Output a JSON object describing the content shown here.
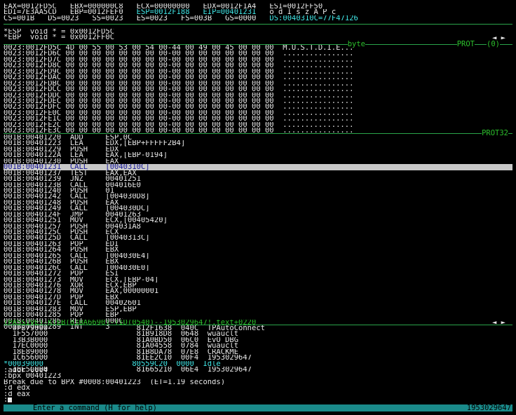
{
  "registers": {
    "row1": [
      "EAX=0012FD5C",
      "EBX=000000C8",
      "ECX=00000000",
      "EDX=0012F1A4",
      "ESI=0012FF50"
    ],
    "row2": [
      "EDI=7E3AA5CD",
      "EBP=0012FEF0",
      "ESP=0012F188",
      "EIP=00401231",
      "o d I s z A P c"
    ],
    "row3": [
      "CS=001B",
      "DS=0023",
      "SS=0023",
      "ES=0023",
      "FS=003B",
      "GS=0000",
      "DS:0040310C=77F47126"
    ]
  },
  "watch": {
    "lines": [
      "*ESP  void * = 0x0012FD5C",
      "*EBP  void * = 0x0012FF0C"
    ],
    "arrows": "◄ ►"
  },
  "data_window": {
    "header": "byte",
    "header_right": "PROT",
    "header_count": "(0)",
    "rows": [
      "0023:0012FD5C 4D 00 55 00 53 00 54 00-44 00 49 00 45 00 00 00  M.U.S.T.D.I.E...",
      "0023:0012FD6C 00 00 00 00 00 00 00 00-00 00 00 00 00 00 00 00  ................",
      "0023:0012FD7C 00 00 00 00 00 00 00 00-00 00 00 00 00 00 00 00  ................",
      "0023:0012FD8C 00 00 00 00 00 00 00 00-00 00 00 00 00 00 00 00  ................",
      "0023:0012FD9C 00 00 00 00 00 00 00 00-00 00 00 00 00 00 00 00  ................",
      "0023:0012FDAC 00 00 00 00 00 00 00 00-00 00 00 00 00 00 00 00  ................",
      "0023:0012FDBC 00 00 00 00 00 00 00 00-00 00 00 00 00 00 00 00  ................",
      "0023:0012FDCC 00 00 00 00 00 00 00 00-00 00 00 00 00 00 00 00  ................",
      "0023:0012FDDC 00 00 00 00 00 00 00 00-00 00 00 00 00 00 00 00  ................",
      "0023:0012FDEC 00 00 00 00 00 00 00 00-00 00 00 00 00 00 00 00  ................",
      "0023:0012FDFC 00 00 00 00 00 00 00 00-00 00 00 00 00 00 00 00  ................",
      "0023:0012FE0C 00 00 00 00 00 00 00 00-00 00 00 00 00 00 00 00  ................",
      "0023:0012FE1C 00 00 00 00 00 00 00 00-00 00 00 00 00 00 00 00  ................",
      "0023:0012FE2C 00 00 00 00 00 00 00 00-00 00 00 00 00 00 00 00  ................",
      "0023:0012FE3C 00 00 00 00 00 00 00 00-00 00 00 00 00 00 00 00  ................"
    ]
  },
  "code_window": {
    "header_right": "PROT32",
    "highlight_index": 5,
    "rows": [
      "001B:00401220  ADD     ESP,0C",
      "001B:00401223  LEA     EDX,[EBP+FFFFF2B4]",
      "001B:00401229  PUSH    EDX",
      "001B:0040122A  LEA     EAX,[EBP-0194]",
      "001B:00401230  PUSH    EAX",
      "001B:00401231  CALL    [0040310C]",
      "001B:00401237  TEST    EAX,EAX",
      "001B:00401239  JNZ     00401251",
      "001B:0040123B  CALL    004016E0",
      "001B:00401240  PUSH    01",
      "001B:00401242  CALL    [004030D8]",
      "001B:00401248  PUSH    EAX",
      "001B:00401249  CALL    [004030DC]",
      "001B:0040124F  JMP     00401263",
      "001B:00401251  MOV     ECX,[00405420]",
      "001B:00401257  PUSH    004031A8",
      "001B:0040125C  PUSH    ECX",
      "001B:0040125D  CALL    [0040313C]",
      "001B:00401263  POP     EDI",
      "001B:00401264  PUSH    EBX",
      "001B:00401265  CALL    [004030E4]",
      "001B:0040126B  PUSH    EBX",
      "001B:0040126C  CALL    [004030E0]",
      "001B:00401272  POP     ESI",
      "001B:00401273  MOV     ECX,[EBP-04]",
      "001B:00401276  XOR     ECX,EBP",
      "001B:00401278  MOV     EAX,00000001",
      "001B:0040127D  POP     EBX",
      "001B:0040127E  CALL    00402601",
      "001B:00401283  MOV     ESP,EBP",
      "001B:00401285  POP     EBP",
      "001B:00401286  RET     000C",
      "001B:00401289  INT     3"
    ],
    "status": "(PASSIVE)-KTEB(81BA6690)-TID(0540)--1953029647!.text+0220"
  },
  "process_window": {
    "current_index": 6,
    "rows": [
      "  0FB79000                    812F1638  040C  TPAutoConnect",
      "  1F557000                    81B918D8  0648  wuauclt",
      "  13B3B000                    81A0BD50  06C0  EvO_DBG",
      "  17EC0000                    81A04558  0784  wuauclt",
      "  18E89000                    81B8DA78  07E8  CRACKME",
      "  1C656000                    81EE2C10  00F4  1953029647",
      "*00039000                    80559C20  0000  Idle",
      "  16E5C000                    81665210  06E4  1953029647"
    ]
  },
  "command_window": {
    "lines": [
      ":addr 06e4",
      ":bpx 00401223",
      "Break due to BPX #0008:00401223  (ET=1.19 seconds)",
      ":d edx",
      ":d eax"
    ],
    "prompt": ":",
    "hint": "Enter a command (H for help)",
    "process_name": "1953029647"
  }
}
